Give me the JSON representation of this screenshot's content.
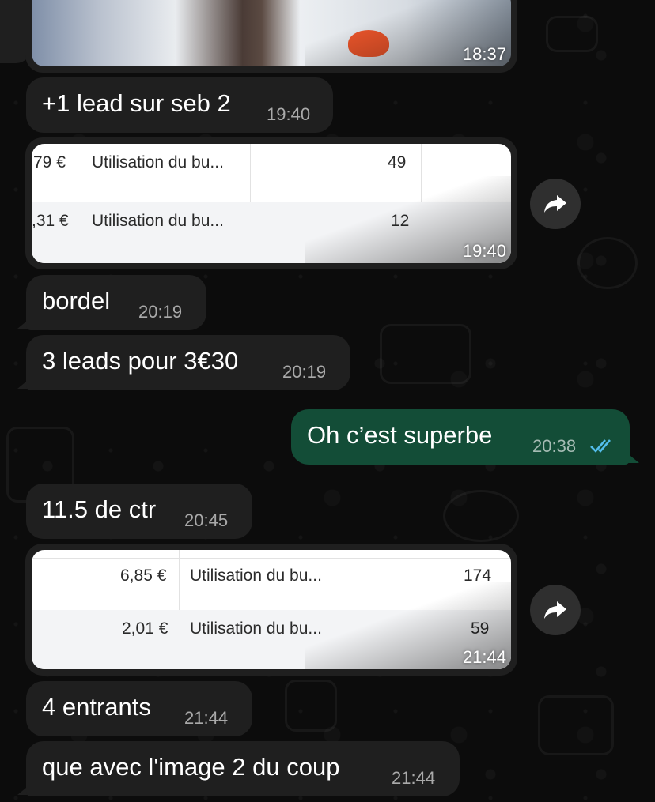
{
  "messages": [
    {
      "kind": "image",
      "caption_time": "18:37"
    },
    {
      "kind": "text",
      "text": "+1 lead sur seb 2",
      "time": "19:40"
    },
    {
      "kind": "table_image",
      "time": "19:40",
      "rows": [
        {
          "amount": "79 €",
          "desc": "Utilisation du bu...",
          "count": "49"
        },
        {
          "amount": ",31 €",
          "desc": "Utilisation du bu...",
          "count": "12"
        }
      ]
    },
    {
      "kind": "text",
      "text": "bordel",
      "time": "20:19"
    },
    {
      "kind": "text",
      "text": "3 leads pour 3€30",
      "time": "20:19"
    },
    {
      "kind": "text_out",
      "text": "Oh c’est superbe",
      "time": "20:38",
      "status": "read"
    },
    {
      "kind": "text",
      "text": "11.5 de ctr",
      "time": "20:45"
    },
    {
      "kind": "table_image",
      "time": "21:44",
      "rows": [
        {
          "amount": "6,85 €",
          "desc": "Utilisation du bu...",
          "count": "174"
        },
        {
          "amount": "2,01 €",
          "desc": "Utilisation du bu...",
          "count": "59"
        }
      ]
    },
    {
      "kind": "text",
      "text": "4 entrants",
      "time": "21:44"
    },
    {
      "kind": "text",
      "text": "que avec l'image 2 du coup",
      "time": "21:44"
    }
  ],
  "icons": {
    "forward": "forward-arrow-icon",
    "read_receipt": "double-check-icon"
  },
  "colors": {
    "incoming_bubble": "#1f1f1f",
    "outgoing_bubble": "#134d37",
    "read_ticks": "#53bdeb",
    "background": "#0c0c0c"
  }
}
